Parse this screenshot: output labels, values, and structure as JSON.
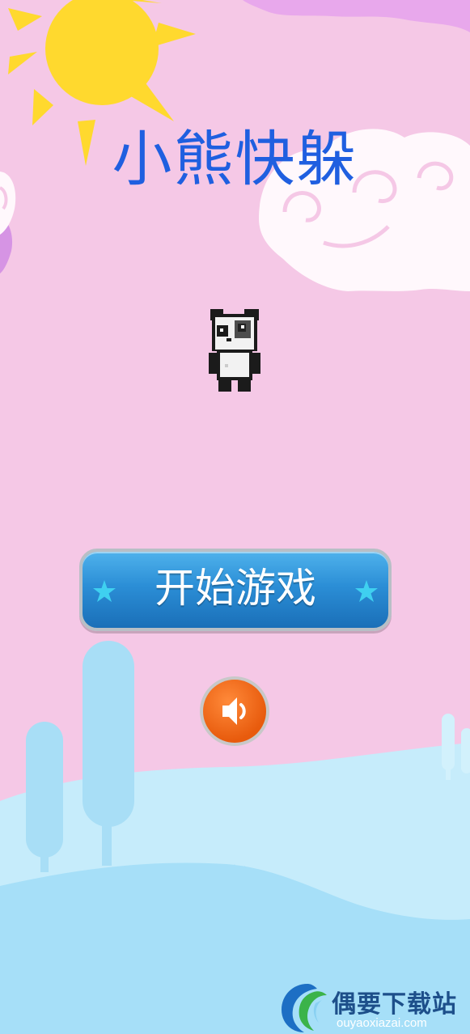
{
  "game": {
    "title": "小熊快躲",
    "start_label": "开始游戏"
  },
  "watermark": {
    "name": "偶要下载站",
    "url": "ouyaoxiazai.com"
  },
  "icons": {
    "sound": "speaker-icon",
    "panda": "panda-character",
    "sun": "sun-icon"
  },
  "colors": {
    "background": "#f5c8e6",
    "title": "#1f5fe0",
    "button": "#2b8ed6",
    "sound_button": "#e8621a",
    "ground_light": "#c6ecfb",
    "ground_dark": "#a6dff8"
  }
}
